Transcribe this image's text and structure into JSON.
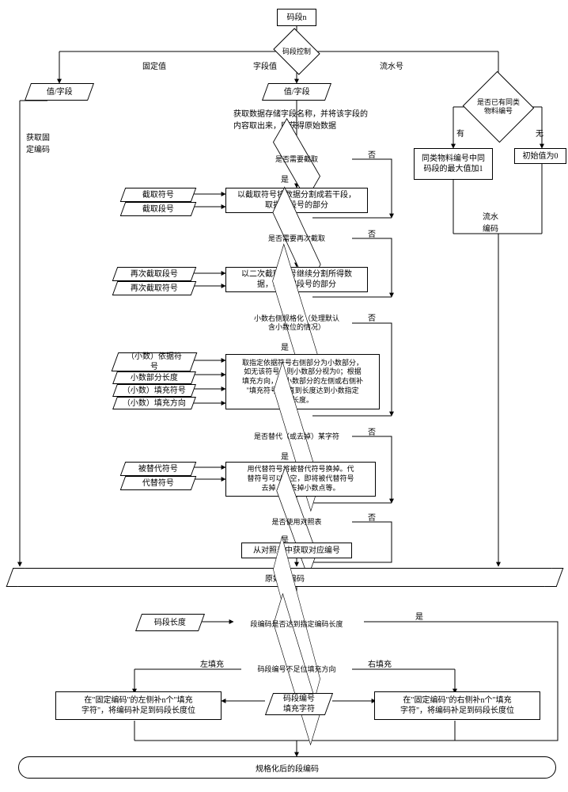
{
  "start": "码段n",
  "control": "码段控制",
  "branches": {
    "fixed": "固定值",
    "field": "字段值",
    "serial": "流水号"
  },
  "fixed_path": {
    "value_field": "值/字段",
    "get_fixed": "获取固\n定编码"
  },
  "field_path": {
    "value_field": "值/字段",
    "note": "获取数据存储字段名称，并将该字段的\n内容取出来，即获得原始数据",
    "need_trunc": "是否需要截取",
    "trunc_sym": "截取符号",
    "trunc_seg": "截取段号",
    "trunc_action": "以截取符号将数据分割成若干段，\n取指定段号的部分",
    "need_trunc2": "是否需要再次截取",
    "trunc2_seg": "再次截取段号",
    "trunc2_sym": "再次截取符号",
    "trunc2_action": "以二次截取符号继续分割所得数\n据，取指定段号的部分",
    "dec_norm": "小数右侧规格化（处理默认\n含小数位的情况）",
    "dec_basis": "（小数）依据符\n号",
    "dec_len": "小数部分长度",
    "dec_fill_sym": "（小数）填充符号",
    "dec_fill_dir": "（小数）填充方向",
    "dec_action": "取指定依据符号右侧部分为小数部分，\n如无该符号，则小数部分视为0；根据\n填充方向，在小数部分的左侧或右侧补\n\"填充符号\"，直到长度达到小数指定\n长度。",
    "replace_q": "是否替代（或去掉）某字符",
    "replaced_sym": "被替代符号",
    "replace_sym": "代替符号",
    "replace_action": "用代替符号将被替代符号换掉。代\n替符号可以是空，即将被代替符号\n去掉，如去掉小数点等。",
    "use_table": "是否使用对照表",
    "from_table": "从对照表中获取对应编号"
  },
  "serial_path": {
    "has_same": "是否已有同类\n物料编号",
    "has": "有",
    "none": "无",
    "same_action": "同类物料编号中同\n码段的最大值加1",
    "init": "初始值为0",
    "serial_code": "流水\n编码"
  },
  "yes": "是",
  "no": "否",
  "raw_seg": "原始段编码",
  "seg_len": "码段长度",
  "len_check": "段编码是否达到指定编码长度",
  "fill_dir": "码段编号不足位填充方向",
  "left_fill": "左填充",
  "right_fill": "右填充",
  "fill_char": "码段编号\n填充字符",
  "left_action": "在\"固定编码\"的左侧补n个\"填充\n字符\"，将编码补足到码段长度位",
  "right_action": "在\"固定编码\"的右侧补n个\"填充\n字符\"，将编码补足到码段长度位",
  "final": "规格化后的段编码"
}
